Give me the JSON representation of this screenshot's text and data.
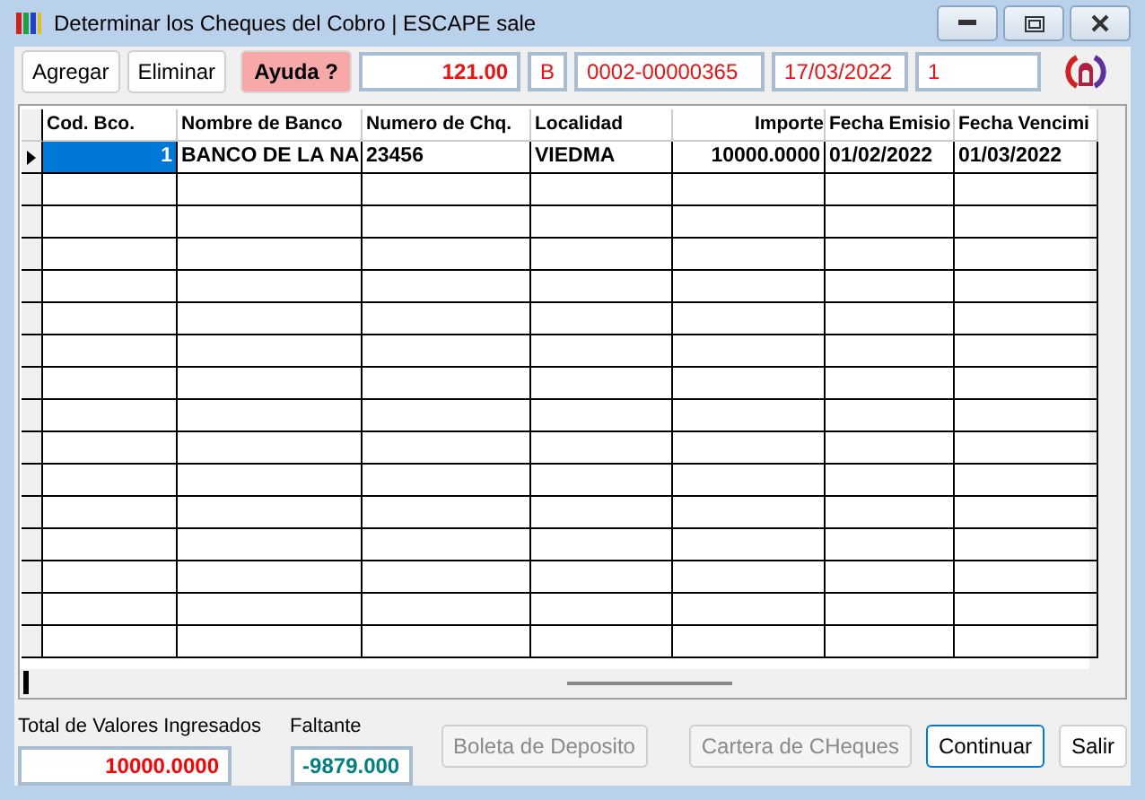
{
  "window": {
    "title": "Determinar los Cheques del Cobro | ESCAPE sale"
  },
  "toolbar": {
    "buttons": [
      {
        "label": "Agregar"
      },
      {
        "label": "Eliminar"
      }
    ],
    "help": "Ayuda ?",
    "fields": [
      "121.00",
      "B",
      "0002-00000365",
      "17/03/2022",
      "1"
    ]
  },
  "table": {
    "columns": [
      "Cod. Bco.",
      "Nombre de Banco",
      "Numero de Chq.",
      "Localidad",
      "Importe",
      "Fecha Emisio",
      "Fecha Vencimi"
    ],
    "rows": [
      {
        "selected": true,
        "cells": [
          "1",
          "BANCO DE LA NA",
          "23456",
          "VIEDMA",
          "10000.0000",
          "01/02/2022",
          "01/03/2022"
        ]
      }
    ]
  },
  "totals": [
    {
      "label": "Total de Valores Ingresados",
      "value": "10000.0000",
      "color": "#ff0000"
    },
    {
      "label": "Faltante",
      "value": "-9879.000",
      "color": "#008080"
    }
  ],
  "buttons": [
    {
      "label": "Boleta de Deposito",
      "disabled": true,
      "default": false
    },
    {
      "label": "Cartera de CHeques",
      "disabled": true,
      "default": false
    },
    {
      "label": "Continuar",
      "disabled": false,
      "default": true
    },
    {
      "label": "Salir",
      "disabled": false,
      "default": false
    }
  ]
}
